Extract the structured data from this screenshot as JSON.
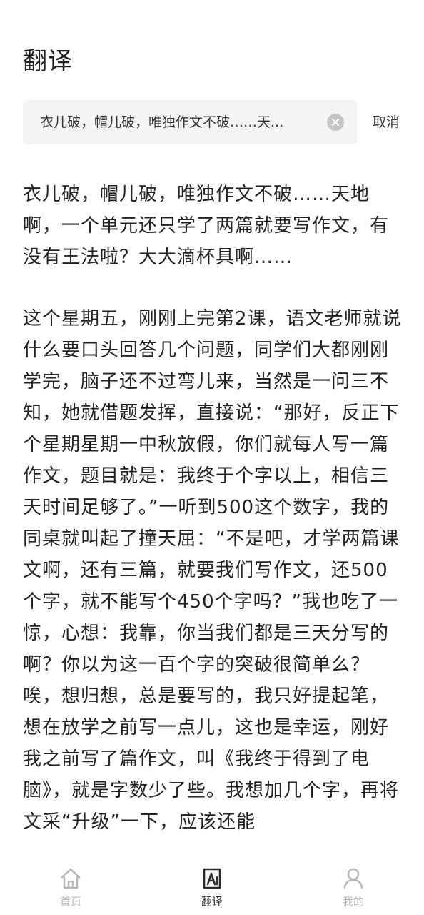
{
  "header": {
    "title": "翻译"
  },
  "search": {
    "query": "衣儿破，帽儿破，唯独作文不破……天...",
    "clear_icon": "clear-icon",
    "cancel_label": "取消"
  },
  "content": {
    "paragraphs": [
      "衣儿破，帽儿破，唯独作文不破……天地啊，一个单元还只学了两篇就要写作文，有没有王法啦？大大滴杯具啊……",
      "这个星期五，刚刚上完第2课，语文老师就说什么要口头回答几个问题，同学们大都刚刚学完，脑子还不过弯儿来，当然是一问三不知，她就借题发挥，直接说：“那好，反正下个星期星期一中秋放假，你们就每人写一篇作文，题目就是：我终于个字以上，相信三天时间足够了。”一听到500这个数字，我的同桌就叫起了撞天屈：“不是吧，才学两篇课文啊，还有三篇，就要我们写作文，还500个字，就不能写个450个字吗？”我也吃了一惊，心想：我靠，你当我们都是三天分写的啊？你以为这一百个字的突破很简单么？唉，想归想，总是要写的，我只好提起笔，想在放学之前写一点儿，这也是幸运，刚好我之前写了篇作文，叫《我终于得到了电脑》，就是字数少了些。我想加几个字，再将文采“升级”一下，应该还能"
    ]
  },
  "nav": {
    "items": [
      {
        "label": "首页",
        "icon": "home-icon",
        "active": false
      },
      {
        "label": "翻译",
        "icon": "translate-icon",
        "active": true
      },
      {
        "label": "我的",
        "icon": "user-icon",
        "active": false
      }
    ]
  },
  "colors": {
    "active_nav": "#2b2b2b",
    "inactive_nav": "#b7b7b7",
    "search_background": "#f4f4f4",
    "clear_icon_background": "#c4c4c4"
  }
}
